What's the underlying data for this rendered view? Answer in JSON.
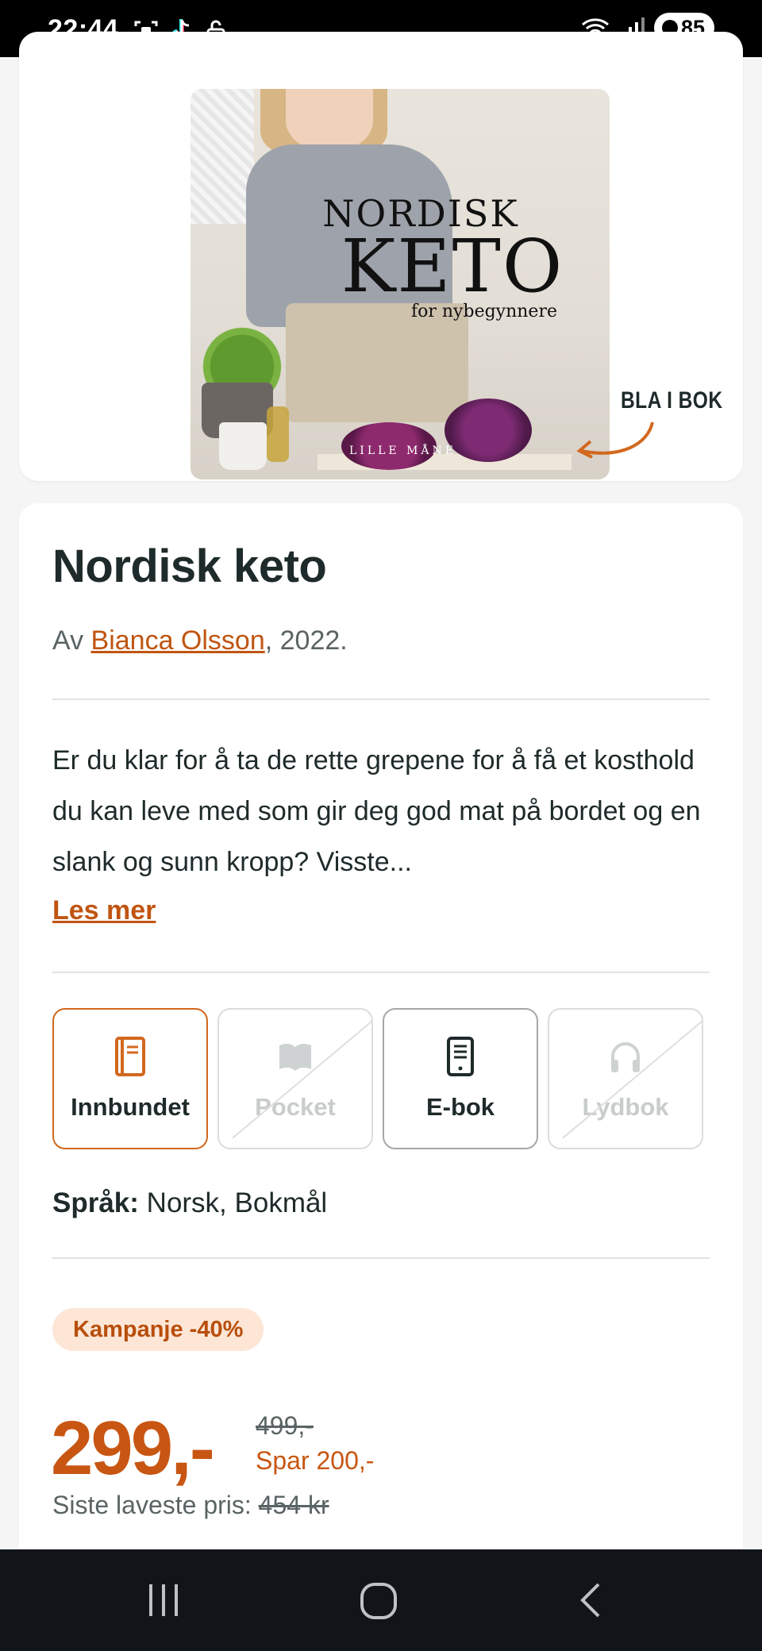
{
  "status_bar": {
    "time": "22:44",
    "battery": "85",
    "icons_left": [
      "screenshot-icon",
      "tiktok-icon",
      "unlock-icon"
    ],
    "icons_right": [
      "wifi-icon",
      "signal-icon",
      "battery-icon"
    ]
  },
  "cover": {
    "title_line1": "NORDISK",
    "title_line2": "KETO",
    "subtitle": "for nybegynnere",
    "publisher": "LILLE MÅNE",
    "peek_label": "BLA I BOK"
  },
  "book": {
    "title": "Nordisk keto",
    "by_prefix": "Av ",
    "author": "Bianca Olsson",
    "year_suffix": ", 2022.",
    "description": "Er du klar for å ta de rette grepene for å få et kosthold du kan leve med som gir deg god mat på bordet og en slank og sunn kropp? Visste...",
    "read_more": "Les mer"
  },
  "formats": [
    {
      "label": "Innbundet",
      "state": "selected",
      "icon": "book-icon"
    },
    {
      "label": "Pocket",
      "state": "unavailable",
      "icon": "open-book-icon"
    },
    {
      "label": "E-bok",
      "state": "available",
      "icon": "ebook-reader-icon"
    },
    {
      "label": "Lydbok",
      "state": "unavailable",
      "icon": "headphones-icon"
    }
  ],
  "language": {
    "label": "Språk:",
    "value": " Norsk, Bokmål"
  },
  "pricing": {
    "campaign_badge": "Kampanje -40%",
    "price": "299,-",
    "old_price": "499,-",
    "save": "Spar 200,-",
    "lowest_label": "Siste laveste pris: ",
    "lowest_value": "454 kr"
  },
  "colors": {
    "accent": "#c85612",
    "badge_bg": "#fde6d6",
    "text": "#1f2a2a"
  }
}
